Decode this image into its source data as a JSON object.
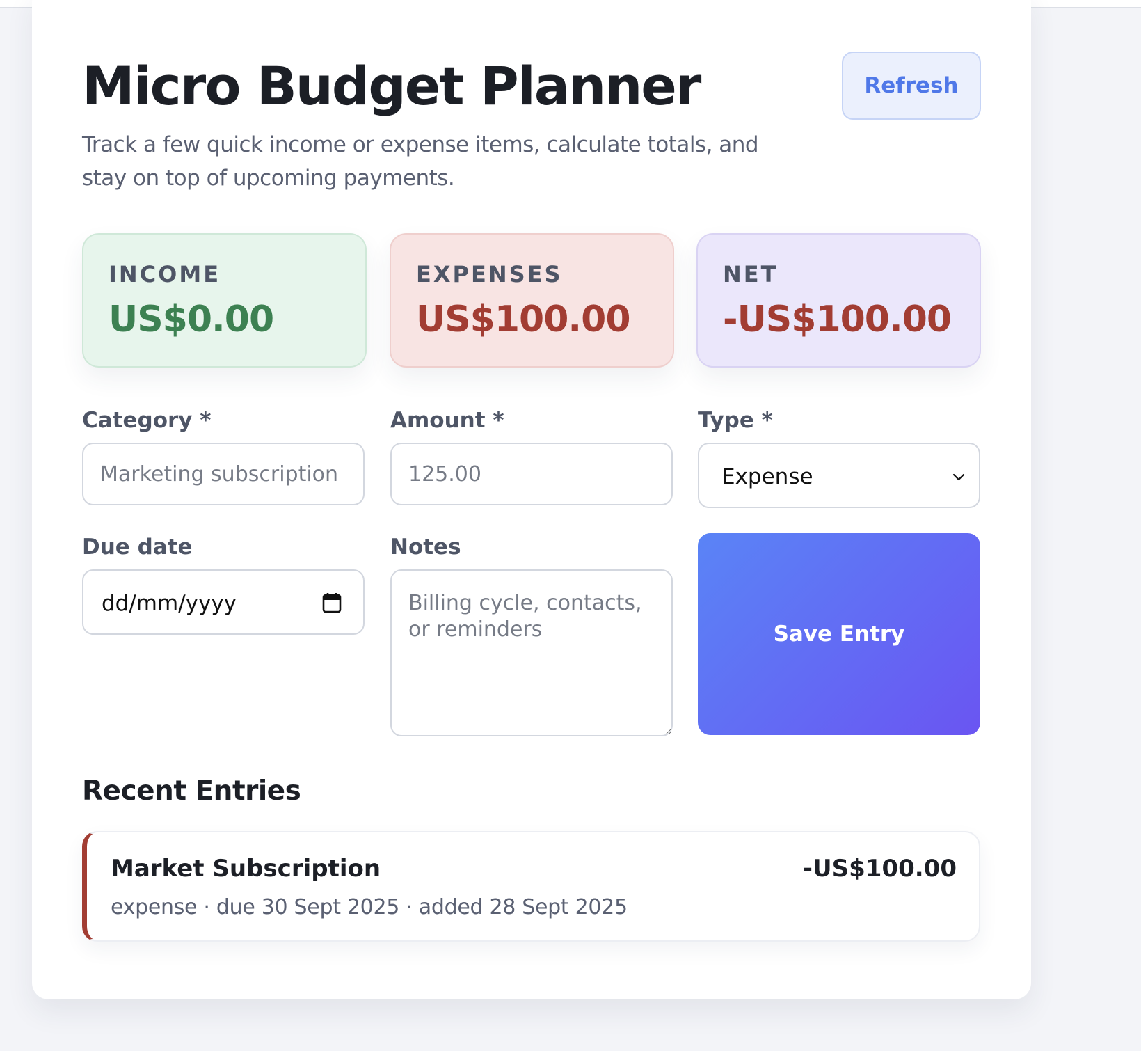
{
  "header": {
    "title": "Micro Budget Planner",
    "subtitle": "Track a few quick income or expense items, calculate totals, and stay on top of upcoming payments.",
    "refresh_label": "Refresh"
  },
  "summary": {
    "income": {
      "label": "INCOME",
      "value": "US$0.00"
    },
    "expenses": {
      "label": "EXPENSES",
      "value": "US$100.00"
    },
    "net": {
      "label": "NET",
      "value": "-US$100.00"
    }
  },
  "form": {
    "category": {
      "label": "Category *",
      "placeholder": "Marketing subscription",
      "value": ""
    },
    "amount": {
      "label": "Amount *",
      "placeholder": "125.00",
      "value": ""
    },
    "type": {
      "label": "Type *",
      "selected": "Expense"
    },
    "due_date": {
      "label": "Due date",
      "value": "dd/mm/yyyy"
    },
    "notes": {
      "label": "Notes",
      "placeholder": "Billing cycle, contacts, or reminders",
      "value": ""
    },
    "save_label": "Save Entry"
  },
  "recent": {
    "title": "Recent Entries",
    "entries": [
      {
        "title": "Market Subscription",
        "amount": "-US$100.00",
        "meta": "expense · due 30 Sept 2025 · added 28 Sept 2025"
      }
    ]
  },
  "colors": {
    "accent": "#4f78e8",
    "income": "#3d8152",
    "expense": "#a23d33",
    "save_gradient_start": "#5a84f6",
    "save_gradient_end": "#6a55f2"
  }
}
